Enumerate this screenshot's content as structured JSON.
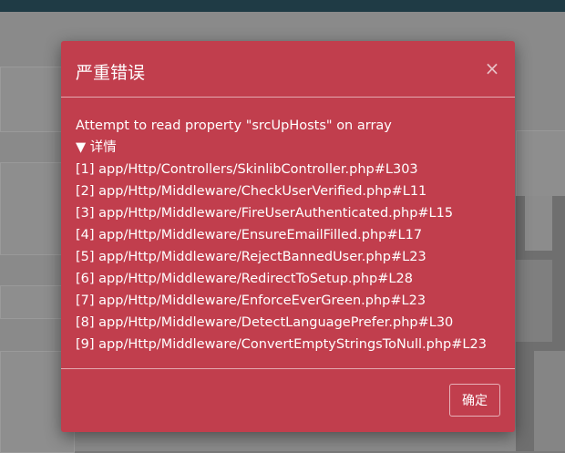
{
  "modal": {
    "title": "严重错误",
    "close_glyph": "×",
    "message": "Attempt to read property \"srcUpHosts\" on array",
    "details_label": "▼ 详情",
    "trace": [
      "[1] app/Http/Controllers/SkinlibController.php#L303",
      "[2] app/Http/Middleware/CheckUserVerified.php#L11",
      "[3] app/Http/Middleware/FireUserAuthenticated.php#L15",
      "[4] app/Http/Middleware/EnsureEmailFilled.php#L17",
      "[5] app/Http/Middleware/RejectBannedUser.php#L23",
      "[6] app/Http/Middleware/RedirectToSetup.php#L28",
      "[7] app/Http/Middleware/EnforceEverGreen.php#L23",
      "[8] app/Http/Middleware/DetectLanguagePrefer.php#L30",
      "[9] app/Http/Middleware/ConvertEmptyStringsToNull.php#L23"
    ],
    "confirm_label": "确定"
  },
  "colors": {
    "modal_background": "#c13e4d",
    "overlay": "#8a8a8a",
    "topbar": "#1f3b45"
  }
}
